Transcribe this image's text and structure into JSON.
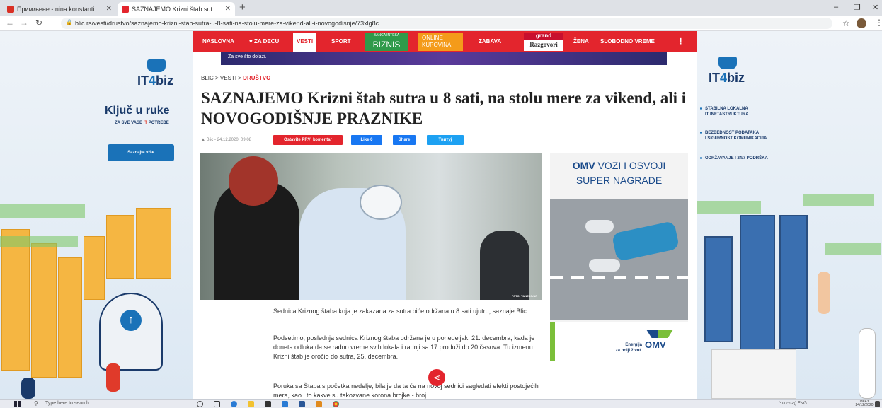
{
  "browser": {
    "tabs": [
      {
        "label": "Примљене - nina.konstantinidis",
        "fav_color": "#d93025"
      },
      {
        "label": "SAZNAJEMO Krizni štab sutra u",
        "fav_color": "#e3252d"
      }
    ],
    "url": "blic.rs/vesti/drustvo/saznajemo-krizni-stab-sutra-u-8-sati-na-stolu-mere-za-vikend-ali-i-novogodisnje/73xlg8c"
  },
  "left_ad": {
    "brand_prefix": "IT",
    "brand_num": "4",
    "brand_suffix": "biz",
    "heading": "Ključ u ruke",
    "sub_before": "ZA SVE VAŠE ",
    "sub_it": "IT",
    "sub_after": " POTREBE",
    "button": "Saznajte više"
  },
  "right_ad": {
    "brand_prefix": "IT",
    "brand_num": "4",
    "brand_suffix": "biz",
    "bullets": [
      {
        "l1": "STABILNA LOKALNA",
        "l2": "IT INFTASTRUKTURA"
      },
      {
        "l1": "BEZBEDNOST PODATAKA",
        "l2": "I SIGURNOST KOMUNIKACIJA"
      },
      {
        "l1": "ODRŽAVANJE I 24/7 PODRŠKA",
        "l2": ""
      }
    ]
  },
  "nav": {
    "items": [
      "NASLOVNA",
      "♥ ZA DECU",
      "VESTI",
      "SPORT",
      "ZABAVA",
      "ŽENA",
      "SLOBODNO VREME"
    ],
    "biz_top": "BANCA INTESA",
    "biz_label": "BIZNIS",
    "online_label_1": "ONLINE",
    "online_label_2": "KUPOVINA",
    "grand_top": "grand",
    "grand_label": "Razgovori",
    "banner_text": "Za sve što dolazi.",
    "more": "⋮"
  },
  "article": {
    "breadcrumb": [
      "BLIC",
      "VESTI",
      "DRUŠTVO"
    ],
    "headline": "SAZNAJEMO Krizni štab sutra u 8 sati, na stolu mere za vikend, ali i NOVOGODIŠNJE PRAZNIKE",
    "author": "Blic",
    "date": "24.12.2020. 09:08",
    "comment_btn": "Ostavite PRVI komentar",
    "like_btn": "Like 0",
    "share_btn": "Share",
    "tweet_btn": "Твитуј",
    "photo_credit": "FOTO: TANJUG/AP",
    "paragraphs": [
      "Sednica Kriznog štaba koja je zakazana za sutra biće održana u 8 sati ujutru, saznaje Blic.",
      "Podsetimo, poslednja sednica Kriznog štaba održana je u ponedeljak, 21. decembra, kada je doneta odluka da se radno vreme svih lokala i radnji sa 17 produži do 20 časova. Tu izmenu Krizni štab je oročio do sutra, 25. decembra.",
      "Poruka sa Štaba s početka nedelje, bila je da ta će na novoj sednici sagledati efekti postojećih mera, kao i to kakve su takozvane korona brojke - broj"
    ]
  },
  "omv_ad": {
    "brand": "OMV",
    "line1_rest": " VOZI I OSVOJI",
    "line2": "SUPER NAGRADE",
    "slogan_1": "Energija",
    "slogan_2": "za bolji život.",
    "logo": "OMV"
  },
  "taskbar": {
    "search": "Type here to search",
    "lang": "ENG",
    "time": "09:43",
    "date": "24/12/2020"
  }
}
